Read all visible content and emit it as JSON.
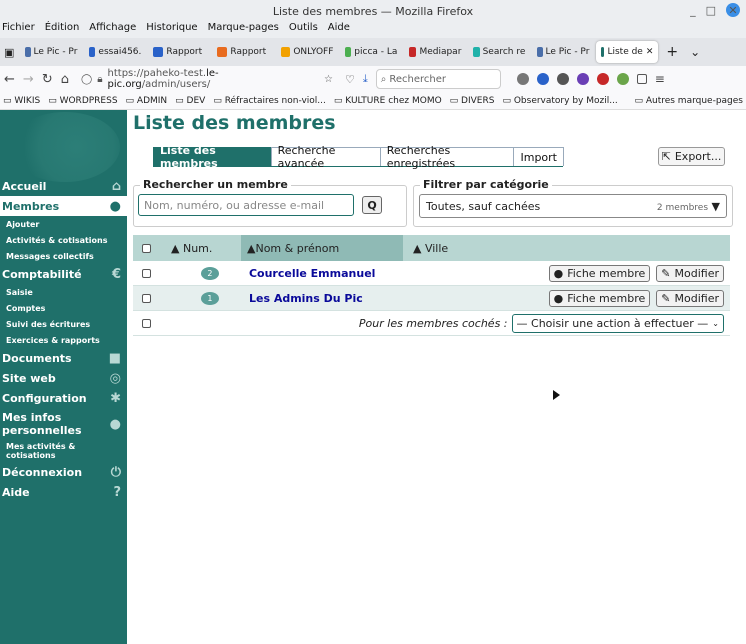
{
  "window": {
    "title": "Liste des membres — Mozilla Firefox"
  },
  "menubar": [
    "Fichier",
    "Édition",
    "Affichage",
    "Historique",
    "Marque-pages",
    "Outils",
    "Aide"
  ],
  "tabs": [
    {
      "label": "Le Pic - Pr",
      "color": "#4a6ea9"
    },
    {
      "label": "essai456.",
      "color": "#2a62c9"
    },
    {
      "label": "Rapport",
      "color": "#2a62c9"
    },
    {
      "label": "Rapport",
      "color": "#e86b1f"
    },
    {
      "label": "ONLYOFF",
      "color": "#f2a100"
    },
    {
      "label": "picca - La",
      "color": "#4caf50"
    },
    {
      "label": "Mediapar",
      "color": "#c62828"
    },
    {
      "label": "Search re",
      "color": "#20b2aa"
    },
    {
      "label": "Le Pic - Pr",
      "color": "#4a6ea9"
    },
    {
      "label": "Liste de",
      "color": "#1f706a"
    }
  ],
  "nav": {
    "url_prefix": "https://paheko-test.",
    "url_domain": "le-pic.org",
    "url_path": "/admin/users/",
    "search_placeholder": "Rechercher"
  },
  "bookmarks": [
    "WIKIS",
    "WORDPRESS",
    "ADMIN",
    "DEV",
    "Réfractaires non-viol...",
    "KULTURE chez MOMO",
    "DIVERS",
    "Observatory by Mozil...",
    "Autres marque-pages"
  ],
  "sidebar": {
    "items": [
      {
        "label": "Accueil",
        "icon": "home-icon",
        "glyph": "⌂"
      },
      {
        "label": "Membres",
        "icon": "users-icon",
        "glyph": "●"
      },
      {
        "label": "Ajouter",
        "sub": true
      },
      {
        "label": "Activités & cotisations",
        "sub": true
      },
      {
        "label": "Messages collectifs",
        "sub": true
      },
      {
        "label": "Comptabilité",
        "icon": "euro-icon",
        "glyph": "€"
      },
      {
        "label": "Saisie",
        "sub": true
      },
      {
        "label": "Comptes",
        "sub": true
      },
      {
        "label": "Suivi des écritures",
        "sub": true
      },
      {
        "label": "Exercices & rapports",
        "sub": true
      },
      {
        "label": "Documents",
        "icon": "folder-icon",
        "glyph": "■"
      },
      {
        "label": "Site web",
        "icon": "globe-icon",
        "glyph": "◎"
      },
      {
        "label": "Configuration",
        "icon": "gear-icon",
        "glyph": "✱"
      },
      {
        "label": "Mes infos personnelles",
        "icon": "user-icon",
        "glyph": "●"
      },
      {
        "label": "Mes activités & cotisations",
        "sub": true
      },
      {
        "label": "Déconnexion",
        "icon": "power-icon",
        "glyph": "⏻"
      },
      {
        "label": "Aide",
        "icon": "help-icon",
        "glyph": "?"
      }
    ]
  },
  "page": {
    "title": "Liste des membres",
    "tabs": [
      "Liste des membres",
      "Recherche avancée",
      "Recherches enregistrées",
      "Import"
    ],
    "export_label": "Export...",
    "search_legend": "Rechercher un membre",
    "search_placeholder": "Nom, numéro, ou adresse e-mail",
    "filter_legend": "Filtrer par catégorie",
    "filter_value": "Toutes, sauf cachées",
    "filter_count": "2 membres"
  },
  "table": {
    "headers": [
      "Num.",
      "Nom & prénom",
      "Ville"
    ],
    "rows": [
      {
        "num": "2",
        "name": "Courcelle Emmanuel"
      },
      {
        "num": "1",
        "name": "Les Admins Du Pic"
      }
    ],
    "fiche_label": "Fiche membre",
    "modifier_label": "Modifier",
    "bulk_label": "Pour les membres cochés :",
    "bulk_select": "— Choisir une action à effectuer —"
  }
}
